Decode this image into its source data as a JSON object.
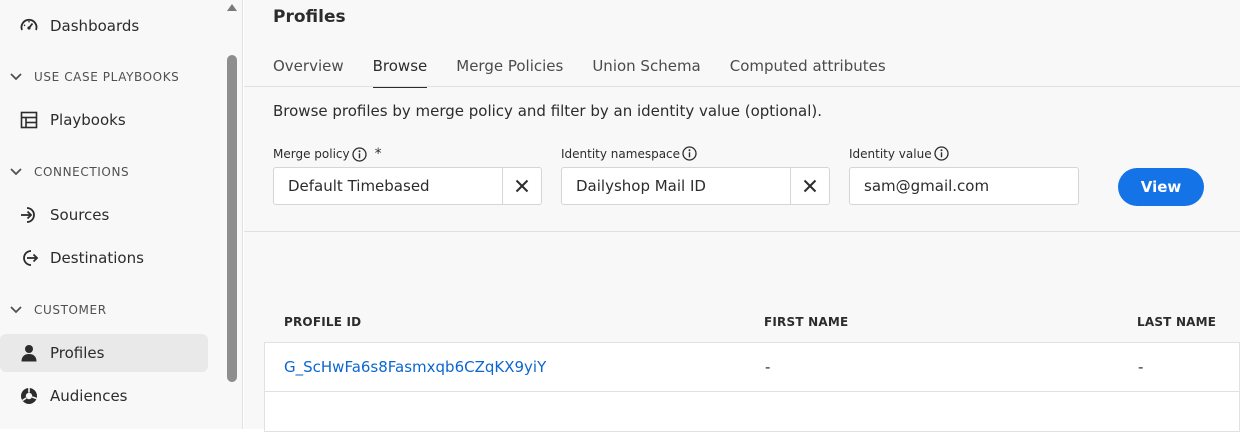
{
  "sidebar": {
    "items": [
      {
        "label": "Dashboards",
        "icon": "gauge-icon"
      },
      {
        "label": "Playbooks",
        "icon": "table-icon"
      },
      {
        "label": "Sources",
        "icon": "arrow-into-icon"
      },
      {
        "label": "Destinations",
        "icon": "arrow-out-icon"
      },
      {
        "label": "Profiles",
        "icon": "user-icon",
        "active": true
      },
      {
        "label": "Audiences",
        "icon": "audiences-icon"
      }
    ],
    "sections": [
      {
        "label": "USE CASE PLAYBOOKS"
      },
      {
        "label": "CONNECTIONS"
      },
      {
        "label": "CUSTOMER"
      }
    ]
  },
  "main": {
    "title": "Profiles",
    "tabs": [
      {
        "label": "Overview"
      },
      {
        "label": "Browse",
        "active": true
      },
      {
        "label": "Merge Policies"
      },
      {
        "label": "Union Schema"
      },
      {
        "label": "Computed attributes"
      }
    ],
    "description": "Browse profiles by merge policy and filter by an identity value (optional).",
    "filters": {
      "merge_policy": {
        "label": "Merge policy",
        "required_mark": "*",
        "value": "Default Timebased"
      },
      "identity_namespace": {
        "label": "Identity namespace",
        "value": "Dailyshop Mail ID"
      },
      "identity_value": {
        "label": "Identity value",
        "value": "sam@gmail.com"
      }
    },
    "view_button": "View",
    "table": {
      "columns": [
        "PROFILE ID",
        "FIRST NAME",
        "LAST NAME"
      ],
      "rows": [
        {
          "profile_id": "G_ScHwFa6s8Fasmxqb6CZqKX9yiY",
          "first_name": "-",
          "last_name": "-"
        }
      ]
    }
  },
  "colors": {
    "accent": "#1473e6",
    "link": "#0d66d0"
  }
}
